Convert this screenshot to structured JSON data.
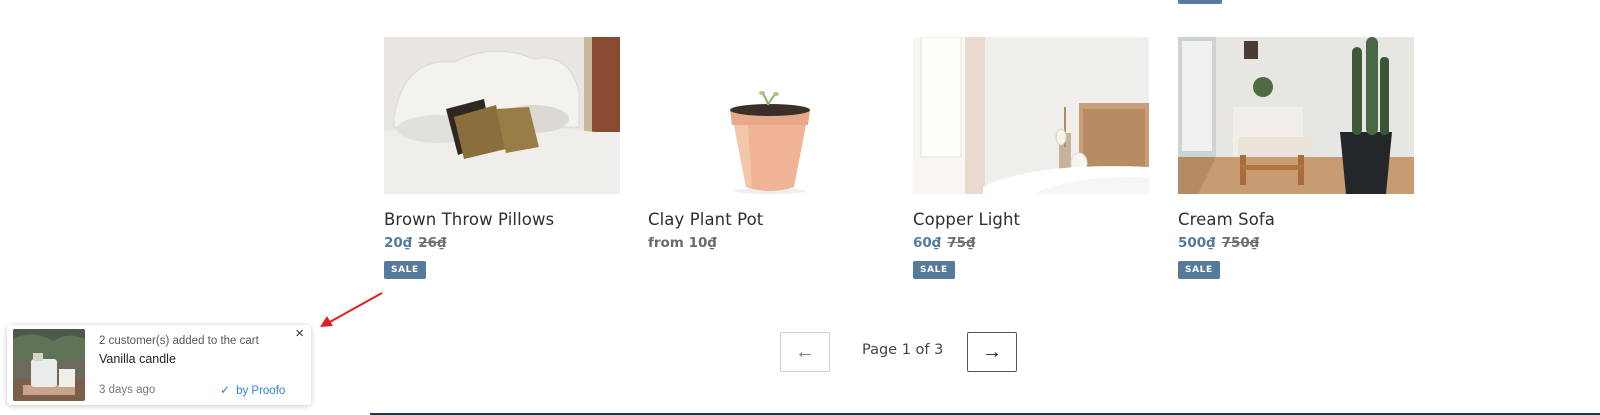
{
  "products": [
    {
      "title": "Brown Throw Pillows",
      "price": "20₫",
      "compare_price": "26₫",
      "badge": "SALE"
    },
    {
      "title": "Clay Plant Pot",
      "price": "from 10₫"
    },
    {
      "title": "Copper Light",
      "price": "60₫",
      "compare_price": "75₫",
      "badge": "SALE"
    },
    {
      "title": "Cream Sofa",
      "price": "500₫",
      "compare_price": "750₫",
      "badge": "SALE"
    }
  ],
  "pagination": {
    "prev_icon": "←",
    "next_icon": "→",
    "label": "Page 1 of 3"
  },
  "notification": {
    "message": "2 customer(s) added to the cart",
    "product": "Vanilla candle",
    "time": "3 days ago",
    "attribution": "by Proofo",
    "close_icon": "×",
    "check_icon": "✓"
  },
  "colors": {
    "accent": "#557a9b",
    "link": "#2d83d8",
    "annotation_arrow": "#e02020"
  }
}
